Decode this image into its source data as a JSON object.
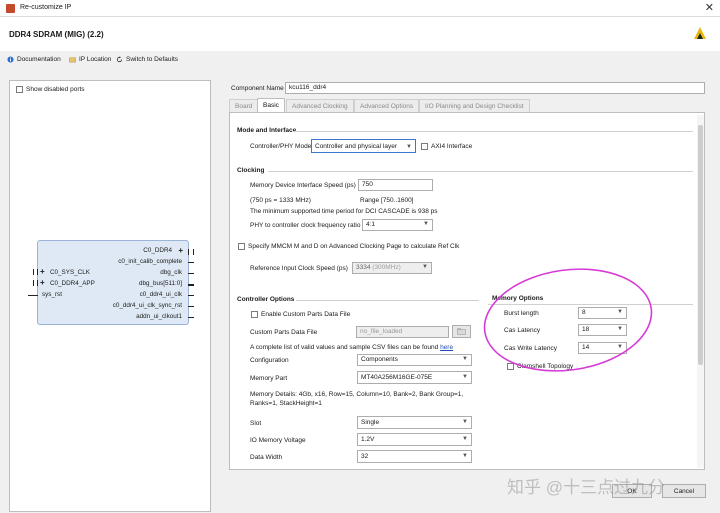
{
  "window": {
    "title": "Re-customize IP",
    "close_glyph": "✕"
  },
  "header": {
    "ip_name": "DDR4 SDRAM (MIG) (2.2)"
  },
  "toolbar": {
    "documentation": "Documentation",
    "ip_location": "IP Location",
    "switch_defaults": "Switch to Defaults"
  },
  "left_panel": {
    "show_disabled_ports": "Show disabled ports",
    "block": {
      "right_ports": [
        "C0_DDR4",
        "c0_init_calib_complete",
        "dbg_clk",
        "dbg_bus[511:0]",
        "c0_ddr4_ui_clk",
        "c0_ddr4_ui_clk_sync_rst",
        "addn_ui_clkout1"
      ],
      "left_ports": [
        "C0_SYS_CLK",
        "C0_DDR4_APP",
        "sys_rst"
      ]
    }
  },
  "component": {
    "label": "Component Name",
    "value": "kcu116_ddr4"
  },
  "tabs": [
    {
      "label": "Board"
    },
    {
      "label": "Basic"
    },
    {
      "label": "Advanced Clocking"
    },
    {
      "label": "Advanced Options"
    },
    {
      "label": "I/O Planning and Design Checklist"
    }
  ],
  "mode": {
    "title": "Mode and Interface",
    "phy_label": "Controller/PHY Mode",
    "phy_value": "Controller and physical layer",
    "axi4": "AXI4 Interface"
  },
  "clocking": {
    "title": "Clocking",
    "speed_label": "Memory Device Interface Speed (ps)",
    "speed_value": "750",
    "mhz_note": "(750 ps = 1333 MHz)",
    "range_note": "Range [750..1600]",
    "min_note": "The minimum supported time period for DCI CASCADE is 938 ps",
    "ratio_label": "PHY to controller clock frequency ratio",
    "ratio_value": "4:1",
    "mmcm_label": "Specify MMCM M and D on Advanced Clocking Page to calculate Ref Clk",
    "ref_label": "Reference Input Clock Speed (ps)",
    "ref_value": "3334",
    "ref_suffix": "(300MHz)"
  },
  "controller": {
    "title": "Controller Options",
    "enable_custom": "Enable Custom Parts Data File",
    "custom_label": "Custom Parts Data File",
    "custom_value": "no_file_loaded",
    "csv_note": "A complete list of valid values and sample CSV files can be found",
    "csv_link": "here",
    "config_label": "Configuration",
    "config_value": "Components",
    "part_label": "Memory Part",
    "part_value": "MT40A256M16GE-075E",
    "details": "Memory Details: 4Gb, x16, Row=15, Column=10, Bank=2, Bank Group=1, Ranks=1, StackHeight=1",
    "slot_label": "Slot",
    "slot_value": "Single",
    "voltage_label": "IO Memory Voltage",
    "voltage_value": "1.2V",
    "width_label": "Data Width",
    "width_value": "32"
  },
  "memory_options": {
    "title": "Memory Options",
    "burst_label": "Burst length",
    "burst_value": "8",
    "cas_label": "Cas Latency",
    "cas_value": "18",
    "cwl_label": "Cas Write Latency",
    "cwl_value": "14",
    "clamshell": "Clamshell Topology"
  },
  "footer": {
    "ok": "OK",
    "cancel": "Cancel"
  },
  "watermark": "知乎 @十三点过九分",
  "colors": {
    "annotation": "#d63bd6",
    "link": "#1f4fb0",
    "block_fill": "#dfe9f5"
  }
}
